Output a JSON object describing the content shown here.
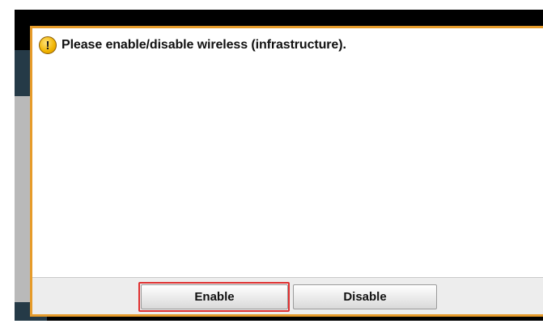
{
  "dialog": {
    "message": "Please enable/disable wireless (infrastructure).",
    "icon": "warning-icon"
  },
  "buttons": {
    "enable_label": "Enable",
    "disable_label": "Disable"
  },
  "colors": {
    "dialog_border": "#e69b2a",
    "highlight": "#e03131",
    "background_dark": "#253a47"
  }
}
